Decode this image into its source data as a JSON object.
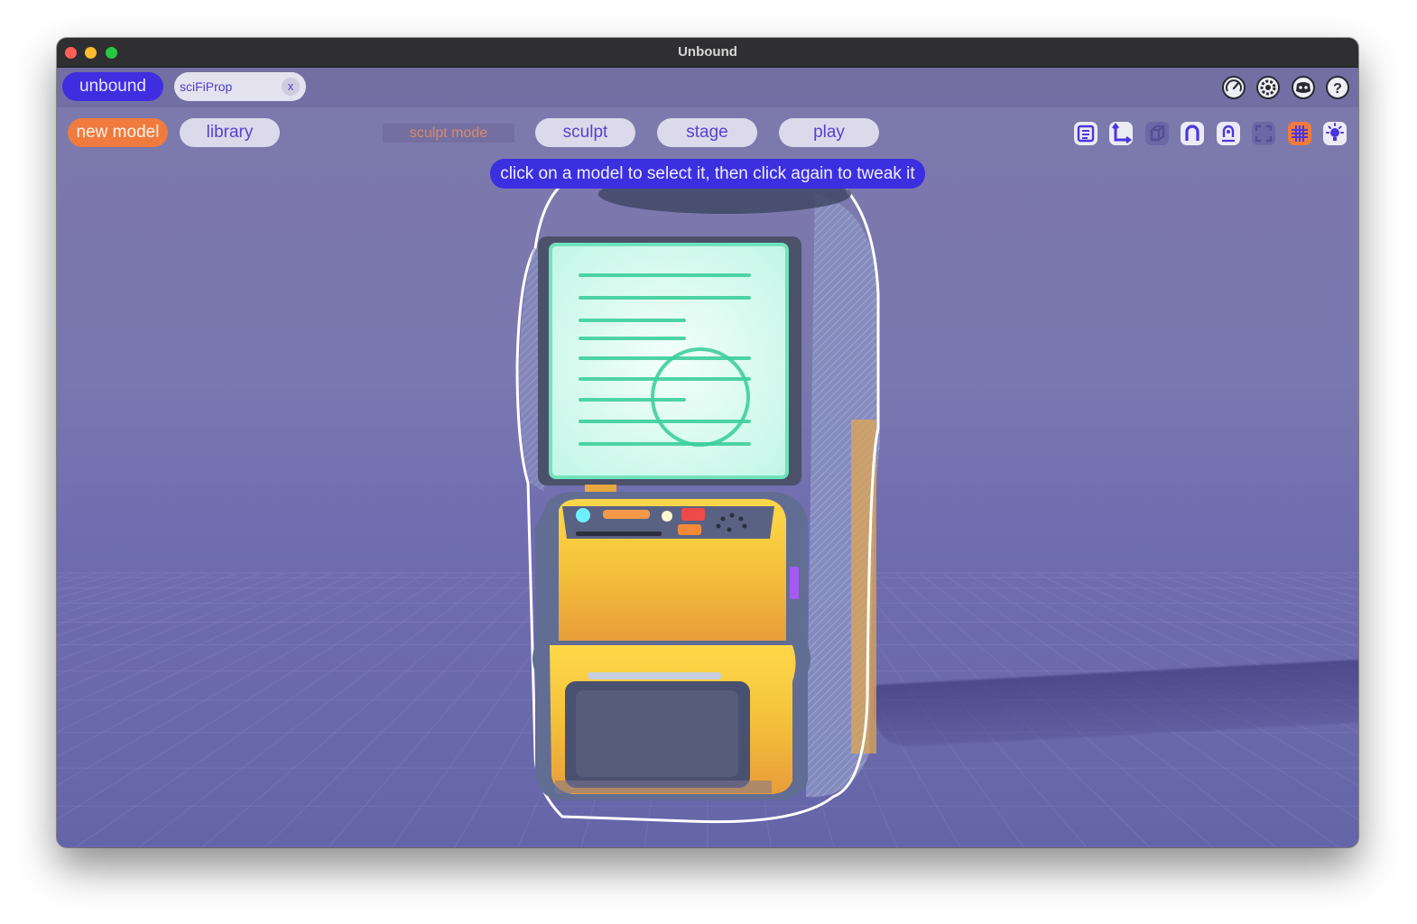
{
  "window": {
    "title": "Unbound"
  },
  "tabs": {
    "brand_label": "unbound",
    "document_name": "sciFiProp",
    "close_label": "x"
  },
  "toolbar": {
    "new_model_label": "new model",
    "library_label": "library",
    "current_mode_label": "sculpt mode",
    "modes": [
      "sculpt",
      "stage",
      "play"
    ]
  },
  "hint": {
    "text": "click on a model to select it, then click again to tweak it"
  },
  "top_icons": [
    "performance-gauge-icon",
    "settings-gear-icon",
    "discord-icon",
    "help-icon"
  ],
  "tool_icons": [
    {
      "name": "list-panel-icon",
      "active": true
    },
    {
      "name": "axis-transform-icon",
      "active": true
    },
    {
      "name": "cube-icon",
      "active": false
    },
    {
      "name": "magnet-icon",
      "active": true
    },
    {
      "name": "person-magnet-icon",
      "active": true
    },
    {
      "name": "frame-select-icon",
      "active": false
    },
    {
      "name": "grid-icon",
      "active": true,
      "accent": true
    },
    {
      "name": "light-bulb-icon",
      "active": true
    }
  ],
  "colors": {
    "brand": "#3f2ee0",
    "accent": "#ef7b3e",
    "viewport": "#7a78b0",
    "selection_outline": "#ffffff"
  }
}
